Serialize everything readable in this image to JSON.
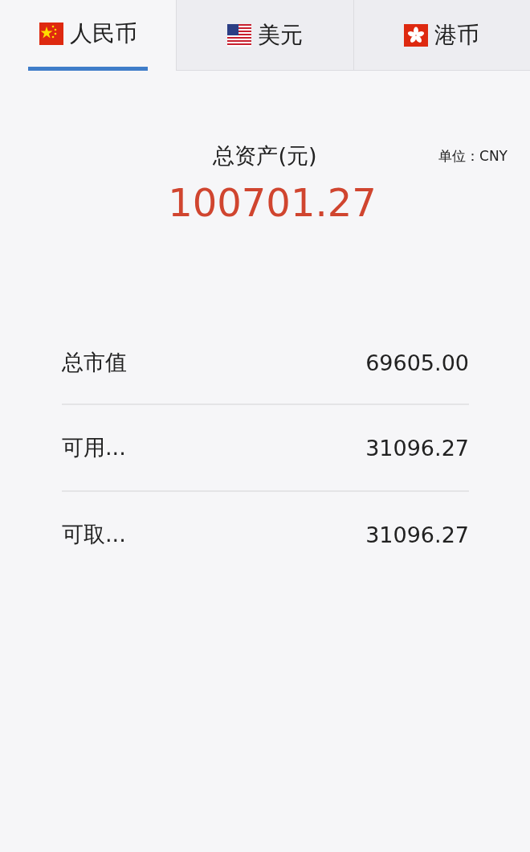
{
  "tabs": [
    {
      "label": "人民币",
      "kind": "cn",
      "selected": true
    },
    {
      "label": "美元",
      "kind": "us",
      "selected": false
    },
    {
      "label": "港币",
      "kind": "hk",
      "selected": false
    }
  ],
  "summary": {
    "title": "总资产(元)",
    "unit": "单位：CNY",
    "total": "100701.27"
  },
  "rows": [
    {
      "label": "总市值",
      "value": "69605.00"
    },
    {
      "label": "可用...",
      "value": "31096.27"
    },
    {
      "label": "可取...",
      "value": "31096.27"
    }
  ]
}
